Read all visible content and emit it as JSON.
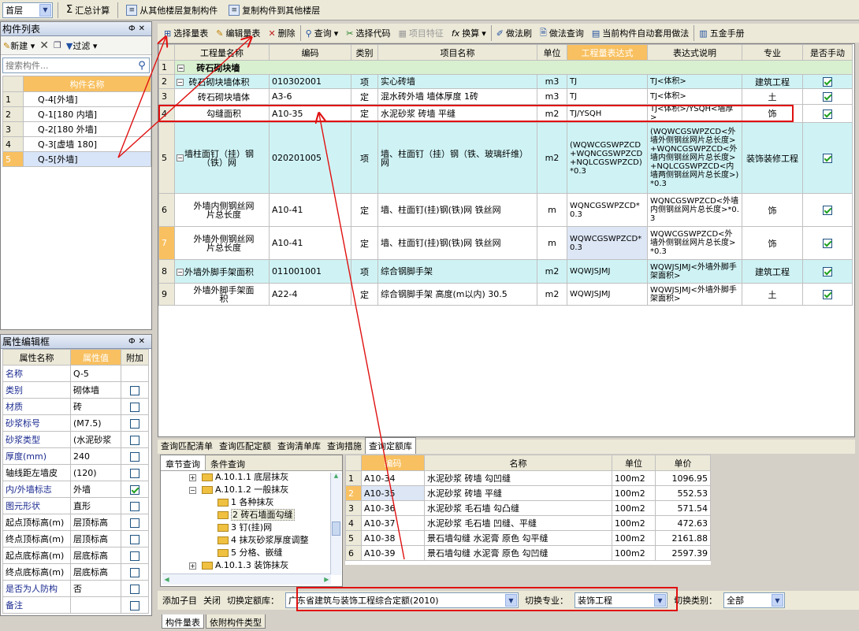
{
  "toolbar_top": {
    "floor": "首层",
    "sum_calc": "汇总计算",
    "copy_from_floor": "从其他楼层复制构件",
    "copy_to_floor": "复制构件到其他楼层"
  },
  "component_list": {
    "title": "构件列表",
    "new_label": "新建",
    "filter_label": "过滤",
    "search_placeholder": "搜索构件...",
    "col_header": "构件名称",
    "items": [
      {
        "no": "1",
        "name": "Q-4[外墙]"
      },
      {
        "no": "2",
        "name": "Q-1[180 内墙]"
      },
      {
        "no": "3",
        "name": "Q-2[180 外墙]"
      },
      {
        "no": "4",
        "name": "Q-3[虚墙 180]"
      },
      {
        "no": "5",
        "name": "Q-5[外墙]"
      }
    ]
  },
  "props": {
    "title": "属性编辑框",
    "col_name": "属性名称",
    "col_value": "属性值",
    "col_add": "附加",
    "rows": [
      {
        "name": "名称",
        "value": "Q-5",
        "check": "none",
        "blue": true
      },
      {
        "name": "类别",
        "value": "砌体墙",
        "check": "off",
        "blue": true
      },
      {
        "name": "材质",
        "value": "砖",
        "check": "off",
        "blue": true
      },
      {
        "name": "砂浆标号",
        "value": "(M7.5)",
        "check": "off",
        "blue": true
      },
      {
        "name": "砂浆类型",
        "value": "(水泥砂浆",
        "check": "off",
        "blue": true
      },
      {
        "name": "厚度(mm)",
        "value": "240",
        "check": "off",
        "blue": true
      },
      {
        "name": "轴线距左墙皮",
        "value": "(120)",
        "check": "off",
        "blue": false
      },
      {
        "name": "内/外墙标志",
        "value": "外墙",
        "check": "on",
        "blue": true
      },
      {
        "name": "图元形状",
        "value": "直形",
        "check": "off",
        "blue": true
      },
      {
        "name": "起点顶标高(m)",
        "value": "层顶标高",
        "check": "off",
        "blue": false
      },
      {
        "name": "终点顶标高(m)",
        "value": "层顶标高",
        "check": "off",
        "blue": false
      },
      {
        "name": "起点底标高(m)",
        "value": "层底标高",
        "check": "off",
        "blue": false
      },
      {
        "name": "终点底标高(m)",
        "value": "层底标高",
        "check": "off",
        "blue": false
      },
      {
        "name": "是否为人防构",
        "value": "否",
        "check": "off",
        "blue": true
      },
      {
        "name": "备注",
        "value": "",
        "check": "off",
        "blue": true
      }
    ]
  },
  "main_toolbar": {
    "select_qty": "选择量表",
    "edit_qty": "编辑量表",
    "delete": "删除",
    "query": "查询",
    "select_code": "选择代码",
    "item_feature": "项目特征",
    "convert": "换算",
    "method_brush": "做法刷",
    "method_query": "做法查询",
    "auto_apply": "当前构件自动套用做法",
    "hardware": "五金手册"
  },
  "qty_table": {
    "headers": [
      "工程量名称",
      "编码",
      "类别",
      "项目名称",
      "单位",
      "工程量表达式",
      "表达式说明",
      "专业",
      "是否手动"
    ],
    "group": {
      "no": "1",
      "name": "砖石砌块墙"
    },
    "rows": [
      {
        "no": "2",
        "name": "砖石砌块墙体积",
        "code": "010302001",
        "cat": "项",
        "proj": "实心砖墙",
        "unit": "m3",
        "expr": "TJ",
        "desc": "TJ<体积>",
        "major": "建筑工程",
        "cyan": true,
        "level": 1,
        "exp": true
      },
      {
        "no": "3",
        "name": "砖石砌块墙体",
        "code": "A3-6",
        "cat": "定",
        "proj": "混水砖外墙 墙体厚度 1砖",
        "unit": "m3",
        "expr": "TJ",
        "desc": "TJ<体积>",
        "major": "土",
        "cyan": false,
        "level": 2,
        "exp": false
      },
      {
        "no": "4",
        "name": "勾缝面积",
        "code": "A10-35",
        "cat": "定",
        "proj": "水泥砂浆 砖墙 平缝",
        "unit": "m2",
        "expr": "TJ/YSQH",
        "desc": "TJ<体积>/YSQH<墙厚>",
        "major": "饰",
        "cyan": false,
        "level": 2,
        "exp": false
      },
      {
        "no": "5",
        "name": "墙柱面钉（挂）钢（铁）网",
        "code": "020201005",
        "cat": "项",
        "proj": "墙、柱面钉（挂）钢（铁、玻璃纤维）网",
        "unit": "m2",
        "expr": "(WQWCGSWPZCD+WQNCGSWPZCD+NQLCGSWPZCD)*0.3",
        "desc": "(WQWCGSWPZCD<外墙外侧钢丝网片总长度>+WQNCGSWPZCD<外墙内侧钢丝网片总长度>+NQLCGSWPZCD<内墙两侧钢丝网片总长度>)*0.3",
        "major": "装饰装修工程",
        "cyan": true,
        "level": 1,
        "exp": true
      },
      {
        "no": "6",
        "name": "外墙内侧钢丝网片总长度",
        "code": "A10-41",
        "cat": "定",
        "proj": "墙、柱面钉(挂)钢(铁)网 铁丝网",
        "unit": "m",
        "expr": "WQNCGSWPZCD*0.3",
        "desc": "WQNCGSWPZCD<外墙内侧钢丝网片总长度>*0.3",
        "major": "饰",
        "cyan": false,
        "level": 2,
        "exp": false
      },
      {
        "no": "7",
        "name": "外墙外侧钢丝网片总长度",
        "code": "A10-41",
        "cat": "定",
        "proj": "墙、柱面钉(挂)钢(铁)网 铁丝网",
        "unit": "m",
        "expr": "WQWCGSWPZCD*0.3",
        "desc": "WQWCGSWPZCD<外墙外侧钢丝网片总长度>*0.3",
        "major": "饰",
        "cyan": false,
        "level": 2,
        "exp": false
      },
      {
        "no": "8",
        "name": "外墙外脚手架面积",
        "code": "011001001",
        "cat": "项",
        "proj": "综合钢脚手架",
        "unit": "m2",
        "expr": "WQWJSJMJ",
        "desc": "WQWJSJMJ<外墙外脚手架面积>",
        "major": "建筑工程",
        "cyan": true,
        "level": 1,
        "exp": true
      },
      {
        "no": "9",
        "name": "外墙外脚手架面积",
        "code": "A22-4",
        "cat": "定",
        "proj": "综合钢脚手架 高度(m以内) 30.5",
        "unit": "m2",
        "expr": "WQWJSJMJ",
        "desc": "WQWJSJMJ<外墙外脚手架面积>",
        "major": "土",
        "cyan": false,
        "level": 2,
        "exp": false
      }
    ]
  },
  "bottom_tabs": [
    "查询匹配清单",
    "查询匹配定额",
    "查询清单库",
    "查询措施",
    "查询定额库"
  ],
  "tree": {
    "tabs": [
      "章节查询",
      "条件查询"
    ],
    "nodes": [
      {
        "label": "A.10.1.1 底层抹灰",
        "indent": 1,
        "exp": "+"
      },
      {
        "label": "A.10.1.2 一般抹灰",
        "indent": 1,
        "exp": "-"
      },
      {
        "label": "1 各种抹灰",
        "indent": 2,
        "exp": ""
      },
      {
        "label": "2 砖石墙面勾缝",
        "indent": 2,
        "exp": "",
        "sel": true
      },
      {
        "label": "3 钉(挂)网",
        "indent": 2,
        "exp": ""
      },
      {
        "label": "4 抹灰砂浆厚度调整",
        "indent": 2,
        "exp": ""
      },
      {
        "label": "5 分格、嵌缝",
        "indent": 2,
        "exp": ""
      },
      {
        "label": "A.10.1.3 装饰抹灰",
        "indent": 1,
        "exp": "+"
      }
    ]
  },
  "quota_table": {
    "headers": [
      "编码",
      "名称",
      "单位",
      "单价"
    ],
    "rows": [
      {
        "no": "1",
        "code": "A10-34",
        "name": "水泥砂浆 砖墙 勾凹缝",
        "unit": "100m2",
        "price": "1096.95"
      },
      {
        "no": "2",
        "code": "A10-35",
        "name": "水泥砂浆 砖墙 平缝",
        "unit": "100m2",
        "price": "552.53"
      },
      {
        "no": "3",
        "code": "A10-36",
        "name": "水泥砂浆 毛石墙 勾凸缝",
        "unit": "100m2",
        "price": "571.54"
      },
      {
        "no": "4",
        "code": "A10-37",
        "name": "水泥砂浆 毛石墙 凹缝、平缝",
        "unit": "100m2",
        "price": "472.63"
      },
      {
        "no": "5",
        "code": "A10-38",
        "name": "景石墙勾缝 水泥膏 原色 勾平缝",
        "unit": "100m2",
        "price": "2161.88"
      },
      {
        "no": "6",
        "code": "A10-39",
        "name": "景石墙勾缝 水泥膏 原色 勾凹缝",
        "unit": "100m2",
        "price": "2597.39"
      }
    ]
  },
  "status_bar": {
    "add_child": "添加子目",
    "close": "关闭",
    "switch_lib_label": "切换定额库：",
    "lib_value": "广东省建筑与装饰工程综合定额(2010)",
    "switch_major_label": "切换专业：",
    "major_value": "装饰工程",
    "switch_cat_label": "切换类别：",
    "cat_value": "全部"
  },
  "bottom_left_tabs": [
    "构件量表",
    "依附构件类型"
  ]
}
